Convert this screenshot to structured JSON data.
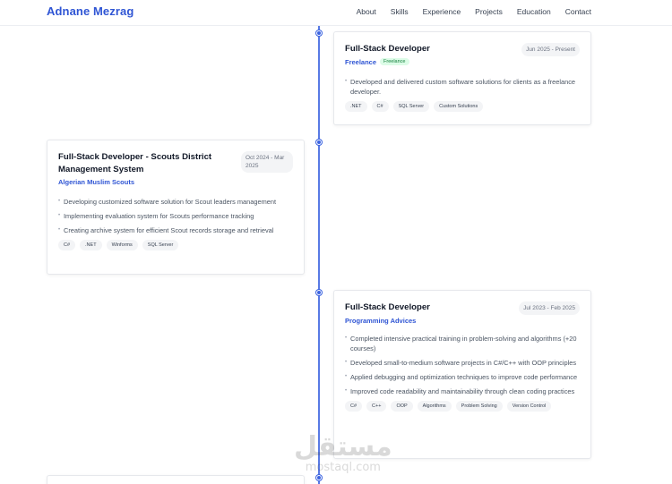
{
  "header": {
    "brand": "Adnane Mezrag",
    "nav": [
      "About",
      "Skills",
      "Experience",
      "Projects",
      "Education",
      "Contact"
    ]
  },
  "experience": [
    {
      "title": "Full-Stack Developer",
      "company": "Freelance",
      "badge": "Freelance",
      "date": "Jun 2025 - Present",
      "bullets": [
        "Developed and delivered custom software solutions for clients as a freelance developer."
      ],
      "tags": [
        ".NET",
        "C#",
        "SQL Server",
        "Custom Solutions"
      ]
    },
    {
      "title": "Full-Stack Developer - Scouts District Management System",
      "company": "Algerian Muslim Scouts",
      "date": "Oct 2024 - Mar 2025",
      "bullets": [
        "Developing customized software solution for Scout leaders management",
        "Implementing evaluation system for Scouts performance tracking",
        "Creating archive system for efficient Scout records storage and retrieval"
      ],
      "tags": [
        "C#",
        ".NET",
        "Winforms",
        "SQL Server"
      ]
    },
    {
      "title": "Full-Stack Developer",
      "company": "Programming Advices",
      "date": "Jul 2023 - Feb 2025",
      "bullets": [
        "Completed intensive practical training in problem-solving and algorithms (+20 courses)",
        "Developed small-to-medium software projects in C#/C++ with OOP principles",
        "Applied debugging and optimization techniques to improve code performance",
        "Improved code readability and maintainability through clean coding practices"
      ],
      "tags": [
        "C#",
        "C++",
        "OOP",
        "Algorithms",
        "Problem Solving",
        "Version Control"
      ]
    }
  ],
  "watermark": {
    "arabic": "مستقل",
    "latin": "mostaql.com"
  },
  "colors": {
    "accent": "#2f55d4",
    "timeline": "#3b63e0"
  }
}
